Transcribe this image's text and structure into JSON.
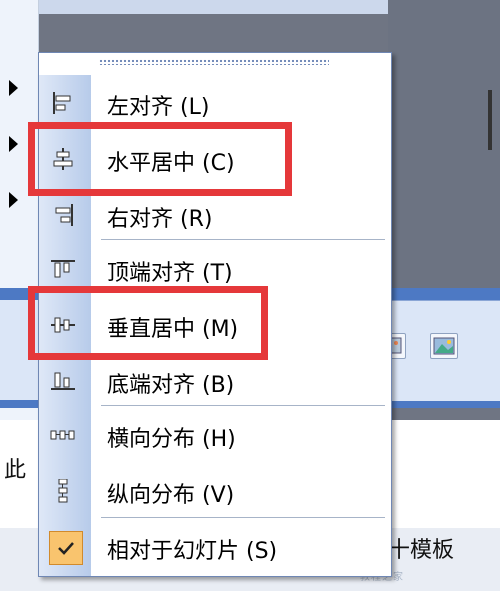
{
  "menu": {
    "items": [
      {
        "label": "左对齐 (L)",
        "icon": "align-left-icon"
      },
      {
        "label": "水平居中 (C)",
        "icon": "align-center-horizontal-icon"
      },
      {
        "label": "右对齐 (R)",
        "icon": "align-right-icon"
      },
      {
        "label": "顶端对齐 (T)",
        "icon": "align-top-icon"
      },
      {
        "label": "垂直居中 (M)",
        "icon": "align-middle-vertical-icon"
      },
      {
        "label": "底端对齐 (B)",
        "icon": "align-bottom-icon"
      },
      {
        "label": "横向分布 (H)",
        "icon": "distribute-horizontal-icon"
      },
      {
        "label": "纵向分布 (V)",
        "icon": "distribute-vertical-icon"
      },
      {
        "label": "相对于幻灯片 (S)",
        "icon": "checkmark-icon",
        "checked": true
      }
    ]
  },
  "background": {
    "left_text": "此",
    "right_text": "十模板",
    "watermark": "教程之家"
  },
  "colors": {
    "highlight": "#e5383a",
    "menu_gutter": "#b7cbea",
    "toolbar_blue": "#4d79c4",
    "check_bg": "#f9c46e"
  }
}
